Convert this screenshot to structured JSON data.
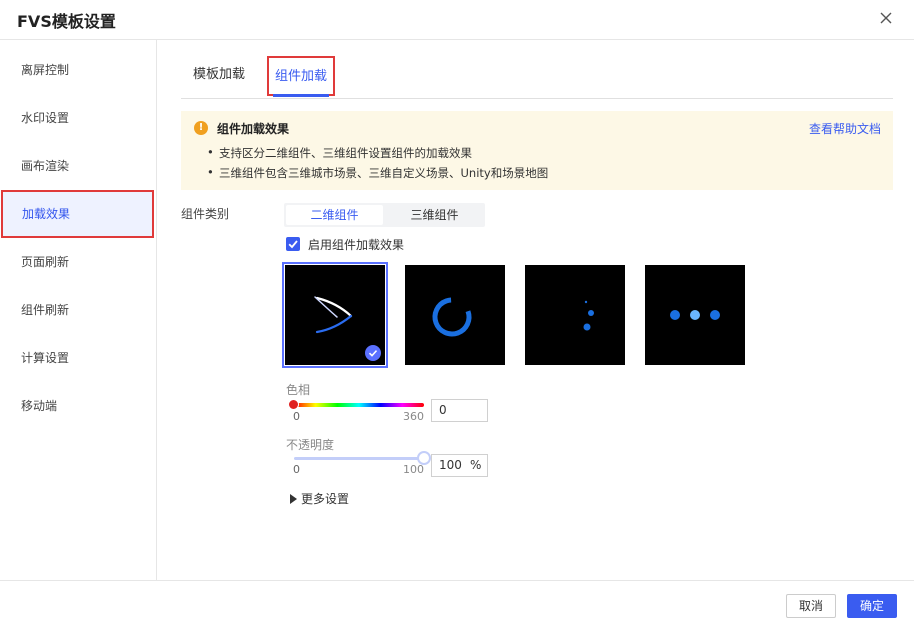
{
  "dialog": {
    "title": "FVS模板设置"
  },
  "sidebar": {
    "items": [
      {
        "label": "离屏控制"
      },
      {
        "label": "水印设置"
      },
      {
        "label": "画布渲染"
      },
      {
        "label": "加载效果"
      },
      {
        "label": "页面刷新"
      },
      {
        "label": "组件刷新"
      },
      {
        "label": "计算设置"
      },
      {
        "label": "移动端"
      }
    ],
    "active": "加载效果"
  },
  "tabs": [
    {
      "label": "模板加载"
    },
    {
      "label": "组件加载"
    }
  ],
  "notice": {
    "title": "组件加载效果",
    "help_link": "查看帮助文档",
    "bullets": [
      "支持区分二维组件、三维组件设置组件的加载效果",
      "三维组件包含三维城市场景、三维自定义场景、Unity和场景地图"
    ]
  },
  "category": {
    "label": "组件类别",
    "options": [
      "二维组件",
      "三维组件"
    ],
    "selected": "二维组件"
  },
  "enable_checkbox": {
    "label": "启用组件加载效果",
    "checked": true
  },
  "effects": {
    "selected_index": 0,
    "count": 4
  },
  "hue": {
    "label": "色相",
    "min": "0",
    "max": "360",
    "value": "0"
  },
  "opacity": {
    "label": "不透明度",
    "min": "0",
    "max": "100",
    "value": "100",
    "unit": "%"
  },
  "more_settings": "更多设置",
  "footer": {
    "cancel": "取消",
    "ok": "确定"
  },
  "colors": {
    "accent": "#3a5cf0",
    "highlight": "#e03a3a",
    "notice_bg": "#fdf8e6",
    "loader_blue": "#1a6fe0"
  }
}
